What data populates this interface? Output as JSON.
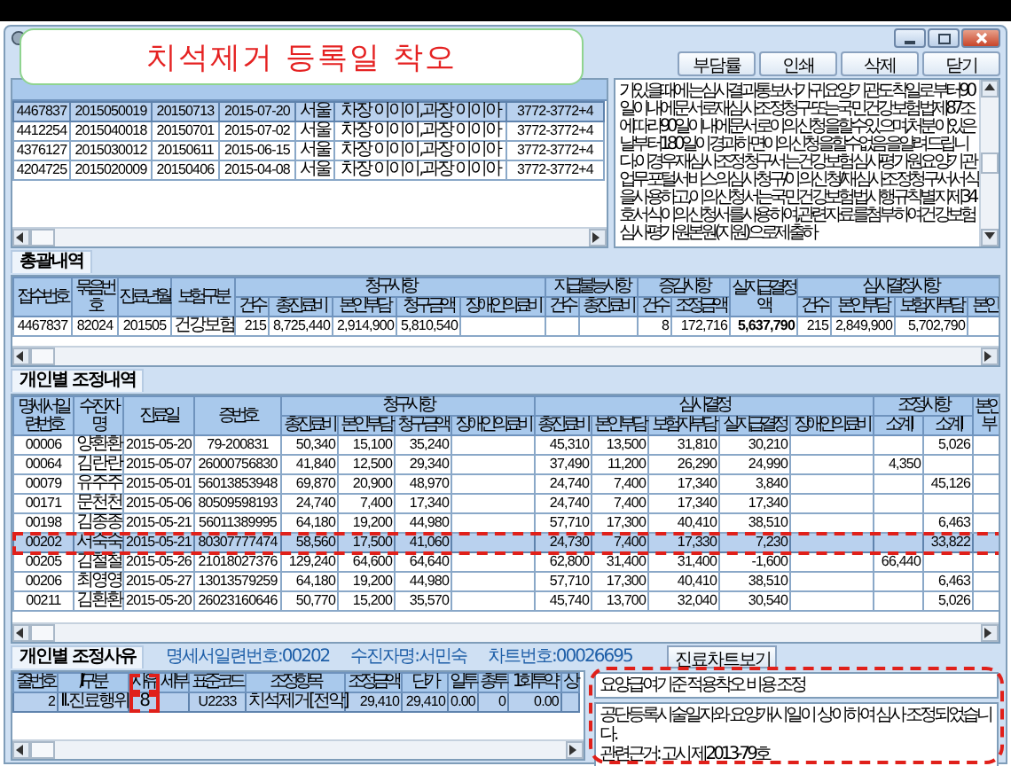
{
  "callout": {
    "text": "치석제거 등록일 착오"
  },
  "toolbar": {
    "buttons": [
      "부담률",
      "인쇄",
      "삭제",
      "닫기"
    ]
  },
  "claims": {
    "columns": [
      {
        "kind": "code"
      },
      {
        "kind": "code"
      },
      {
        "kind": "code"
      },
      {
        "kind": "code"
      },
      {
        "kind": "text"
      },
      {
        "kind": "text"
      },
      {
        "kind": "code"
      }
    ],
    "rows": [
      {
        "cells": [
          "4467837",
          "2015050019",
          "20150713",
          "2015-07-20",
          "서울",
          "차장 이이이,과장 이이아",
          "3772-3772+4"
        ],
        "selected": true
      },
      {
        "cells": [
          "4412254",
          "2015040018",
          "20150701",
          "2015-07-02",
          "서울",
          "차장 이이이,과장 이이아",
          "3772-3772+4"
        ],
        "selected": false
      },
      {
        "cells": [
          "4376127",
          "2015030012",
          "20150611",
          "2015-06-15",
          "서울",
          "차장 이이이,과장 이이아",
          "3772-3772+4"
        ],
        "selected": false
      },
      {
        "cells": [
          "4204725",
          "2015020009",
          "20150406",
          "2015-04-08",
          "서울",
          "차장 이이이,과장 이이아",
          "3772-3772+4"
        ],
        "selected": false
      }
    ]
  },
  "notice": {
    "text": "가 있을 때에는 심사결과통보서가 귀 요양기관 도착일로부터 90일 이내에 문서로 재심사조정청구 또는 국민건강보험법 제87조에 따라 90일 이내에 문서로 이의신청을 할 수 있으며, 처분이 있은 날 부터 180일이 경과하면 이의신청을 할 수 없음을 알려드립니다. 이 경우 재심사조정청구서는 건강보험심사평가원 요양기관 업무포털 서비스의 심사청구/이의신청/재심사조정청구서 서식을 사용하고, 이의신청서는 국민건강보험법 시행규칙 별지 제34호 서식 이의신청서를 사용하여, 관련자료를 첨부하여 건강보험심사평가원 본원(지원)으로 제출하"
  },
  "summary": {
    "title": "총괄내역",
    "columns": [
      {
        "label": "접수번호",
        "kind": "code"
      },
      {
        "label": "묶음번호",
        "kind": "code"
      },
      {
        "label": "진료년월",
        "kind": "code"
      },
      {
        "label": "보험구분"
      },
      {
        "label": "청구사항",
        "colspan": 5,
        "children": [
          {
            "label": "건수",
            "kind": "number"
          },
          {
            "label": "총진료비",
            "kind": "number"
          },
          {
            "label": "본인부담",
            "kind": "number"
          },
          {
            "label": "청구금액",
            "kind": "number"
          },
          {
            "label": "장애인의료비",
            "kind": "number"
          }
        ]
      },
      {
        "label": "지급불능사항",
        "colspan": 2,
        "children": [
          {
            "label": "건수",
            "kind": "number"
          },
          {
            "label": "총진료비",
            "kind": "number"
          }
        ]
      },
      {
        "label": "증감사항",
        "colspan": 2,
        "children": [
          {
            "label": "건수",
            "kind": "number"
          },
          {
            "label": "조정금액",
            "kind": "number"
          }
        ]
      },
      {
        "label": "실지급결정액",
        "kind": "emphasis"
      },
      {
        "label": "심사결정사항",
        "colspan": 4,
        "children": [
          {
            "label": "건수",
            "kind": "number"
          },
          {
            "label": "본인부담",
            "kind": "number"
          },
          {
            "label": "보험자부담",
            "kind": "number"
          },
          {
            "label": "본인",
            "kind": "number"
          }
        ]
      }
    ],
    "rows": [
      {
        "cells": [
          "4467837",
          "82024",
          "201505",
          "건강보험",
          "215",
          "8,725,440",
          "2,914,900",
          "5,810,540",
          "",
          "",
          "",
          "8",
          "172,716",
          "5,637,790",
          "215",
          "2,849,900",
          "5,702,790",
          ""
        ],
        "selected": false
      }
    ]
  },
  "adjustments": {
    "title": "개인별 조정내역",
    "columns": [
      {
        "label": "명세서일련번호",
        "kind": "code"
      },
      {
        "label": "수진자명"
      },
      {
        "label": "진료일",
        "kind": "code"
      },
      {
        "label": "증번호",
        "kind": "code"
      },
      {
        "label": "청구사항",
        "colspan": 4,
        "children": [
          {
            "label": "총진료비",
            "kind": "number"
          },
          {
            "label": "본인부담",
            "kind": "number"
          },
          {
            "label": "청구금액",
            "kind": "number"
          },
          {
            "label": "장애인의료비",
            "kind": "number"
          }
        ]
      },
      {
        "label": "심사결정",
        "colspan": 5,
        "children": [
          {
            "label": "총진료비",
            "kind": "number"
          },
          {
            "label": "본인부담",
            "kind": "number"
          },
          {
            "label": "보험자부담",
            "kind": "number"
          },
          {
            "label": "실지급결정",
            "kind": "number"
          },
          {
            "label": "장애인의료비",
            "kind": "number"
          }
        ]
      },
      {
        "label": "조정사항",
        "colspan": 2,
        "children": [
          {
            "label": "소계I",
            "kind": "number"
          },
          {
            "label": "소계II",
            "kind": "number"
          }
        ]
      },
      {
        "label": "본인부"
      }
    ],
    "rows": [
      {
        "cells": [
          "00006",
          "양환환",
          "2015-05-20",
          "79-200831",
          "50,340",
          "15,100",
          "35,240",
          "",
          "45,310",
          "13,500",
          "31,810",
          "30,210",
          "",
          "",
          "5,026",
          ""
        ],
        "selected": false,
        "highlighted": false
      },
      {
        "cells": [
          "00064",
          "김란란",
          "2015-05-07",
          "26000756830",
          "41,840",
          "12,500",
          "29,340",
          "",
          "37,490",
          "11,200",
          "26,290",
          "24,990",
          "",
          "4,350",
          "",
          ""
        ],
        "selected": false,
        "highlighted": false
      },
      {
        "cells": [
          "00079",
          "유주주",
          "2015-05-01",
          "56013853948",
          "69,870",
          "20,900",
          "48,970",
          "",
          "24,740",
          "7,400",
          "17,340",
          "3,840",
          "",
          "",
          "45,126",
          ""
        ],
        "selected": false,
        "highlighted": false
      },
      {
        "cells": [
          "00171",
          "문천천",
          "2015-05-06",
          "80509598193",
          "24,740",
          "7,400",
          "17,340",
          "",
          "24,740",
          "7,400",
          "17,340",
          "17,340",
          "",
          "",
          "",
          ""
        ],
        "selected": false,
        "highlighted": false
      },
      {
        "cells": [
          "00198",
          "김종종",
          "2015-05-21",
          "56011389995",
          "64,180",
          "19,200",
          "44,980",
          "",
          "57,710",
          "17,300",
          "40,410",
          "38,510",
          "",
          "",
          "6,463",
          ""
        ],
        "selected": false,
        "highlighted": false
      },
      {
        "cells": [
          "00202",
          "서숙숙",
          "2015-05-21",
          "80307777474",
          "58,560",
          "17,500",
          "41,060",
          "",
          "24,730",
          "7,400",
          "17,330",
          "7,230",
          "",
          "",
          "33,822",
          ""
        ],
        "selected": true,
        "highlighted": true
      },
      {
        "cells": [
          "00205",
          "김철철",
          "2015-05-26",
          "21018027376",
          "129,240",
          "64,600",
          "64,640",
          "",
          "62,800",
          "31,400",
          "31,400",
          "-1,600",
          "",
          "66,440",
          "",
          ""
        ],
        "selected": false,
        "highlighted": false
      },
      {
        "cells": [
          "00206",
          "최영영",
          "2015-05-27",
          "13013579259",
          "64,180",
          "19,200",
          "44,980",
          "",
          "57,710",
          "17,300",
          "40,410",
          "38,510",
          "",
          "",
          "6,463",
          ""
        ],
        "selected": false,
        "highlighted": false
      },
      {
        "cells": [
          "00211",
          "김환환",
          "2015-05-20",
          "26023160646",
          "50,770",
          "15,200",
          "35,570",
          "",
          "45,740",
          "13,700",
          "32,040",
          "30,540",
          "",
          "",
          "5,026",
          ""
        ],
        "selected": false,
        "highlighted": false
      }
    ]
  },
  "reasons": {
    "title": "개인별 조정사유",
    "info": [
      "명세서일련번호:00202",
      "수진자명:서민숙",
      "차트번호:00026695"
    ],
    "chart_button": "진료차트보기",
    "columns": [
      {
        "label": "줄번호",
        "kind": "number"
      },
      {
        "label": "I/II 구분"
      },
      {
        "label": "사유",
        "highlighted": true
      },
      {
        "label": "세부"
      },
      {
        "label": "표준코드",
        "kind": "code"
      },
      {
        "label": "조정항목"
      },
      {
        "label": "조정금액",
        "kind": "number"
      },
      {
        "label": "단가",
        "kind": "number"
      },
      {
        "label": "일투",
        "kind": "number"
      },
      {
        "label": "총투",
        "kind": "number"
      },
      {
        "label": "1회투약",
        "kind": "number"
      },
      {
        "label": "상"
      }
    ],
    "rows": [
      {
        "cells": [
          "2",
          "II.진료행위",
          "8",
          "",
          "U2233",
          "치석제거[전악]",
          "29,410",
          "29,410",
          "0.00",
          "0",
          "0.00",
          ""
        ],
        "selected": true
      }
    ],
    "remarks_highlighted": true,
    "remarks": [
      {
        "lines": [
          "요양급여기준 적용착오 비용 조정"
        ]
      },
      {
        "lines": [
          "공단등록시술일자와 요양개시일이 상이하여 심사 조정되었습니다.",
          "관련근거: 고시 제2013-79호"
        ]
      }
    ]
  }
}
